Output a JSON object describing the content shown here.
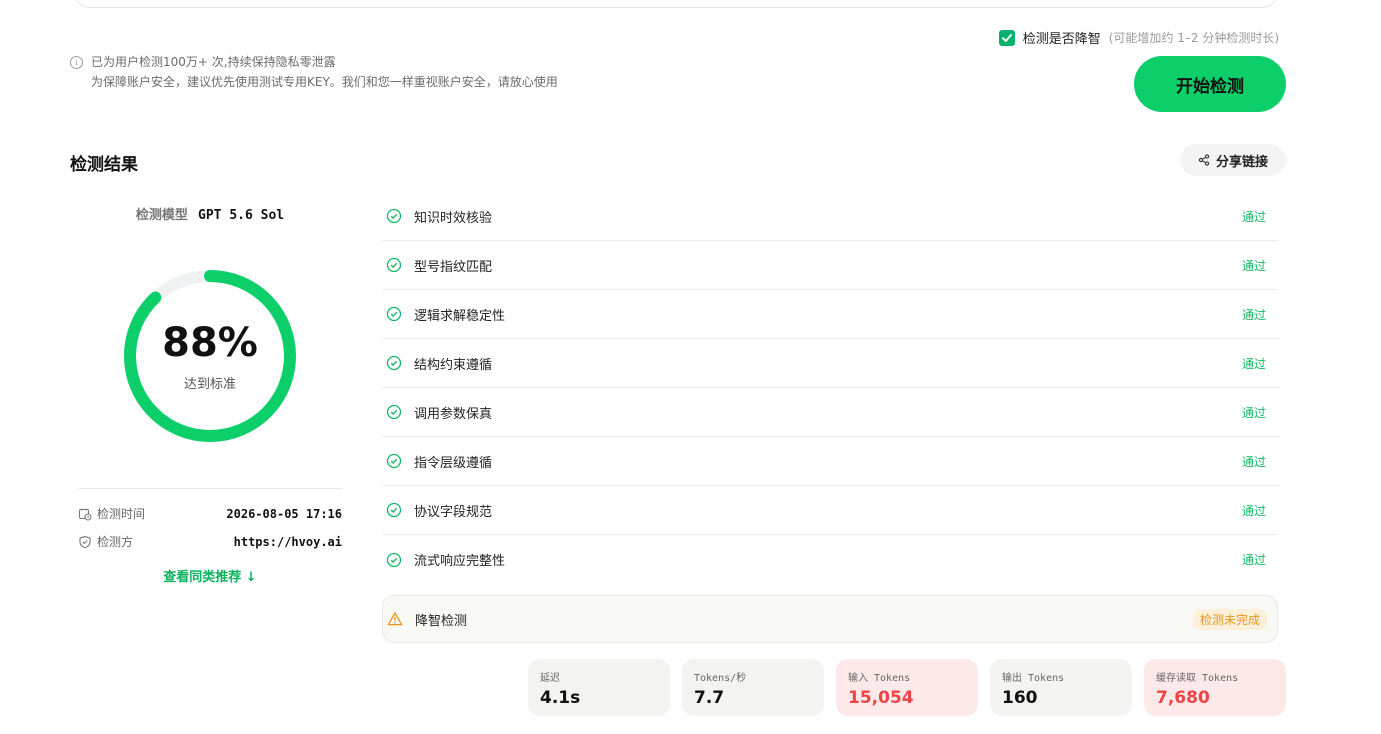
{
  "notice": {
    "line1": "已为用户检测100万+ 次,持续保持隐私零泄露",
    "line2": "为保障账户安全，建议优先使用测试专用KEY。我们和您一样重视账户安全，请放心使用"
  },
  "degrade_option": {
    "checked": true,
    "label": "检测是否降智",
    "hint": "(可能增加约 1–2 分钟检测时长)"
  },
  "start_button": "开始检测",
  "results": {
    "title": "检测结果",
    "share_label": "分享链接",
    "model_label": "检测模型",
    "model_value": "GPT 5.6 Sol",
    "score": {
      "value_text": "88%",
      "fraction": 0.88,
      "sub": "达到标准"
    },
    "meta": {
      "time_label": "检测时间",
      "time_value": "2026-08-05 17:16",
      "provider_label": "检测方",
      "provider_value": "https://hvoy.ai"
    },
    "similar_link": "查看同类推荐 ↓",
    "checks": [
      {
        "name": "知识时效核验",
        "status": "通过"
      },
      {
        "name": "型号指纹匹配",
        "status": "通过"
      },
      {
        "name": "逻辑求解稳定性",
        "status": "通过"
      },
      {
        "name": "结构约束遵循",
        "status": "通过"
      },
      {
        "name": "调用参数保真",
        "status": "通过"
      },
      {
        "name": "指令层级遵循",
        "status": "通过"
      },
      {
        "name": "协议字段规范",
        "status": "通过"
      },
      {
        "name": "流式响应完整性",
        "status": "通过"
      }
    ],
    "degrade_check": {
      "name": "降智检测",
      "status": "检测未完成"
    },
    "stats": [
      {
        "label": "延迟",
        "value": "4.1s",
        "highlight": false
      },
      {
        "label": "Tokens/秒",
        "value": "7.7",
        "highlight": false
      },
      {
        "label": "输入 Tokens",
        "value": "15,054",
        "highlight": true
      },
      {
        "label": "输出 Tokens",
        "value": "160",
        "highlight": false
      },
      {
        "label": "缓存读取 Tokens",
        "value": "7,680",
        "highlight": true
      }
    ]
  },
  "colors": {
    "accent": "#0ccf6a",
    "pass": "#12b864",
    "warning": "#e6951e",
    "highlight": "#ef4444"
  }
}
